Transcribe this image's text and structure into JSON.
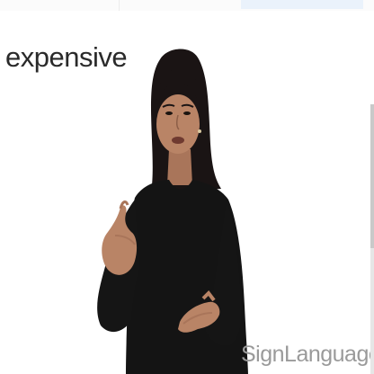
{
  "sign": {
    "word": "expensive"
  },
  "watermark": {
    "text": "SignLanguage.io"
  },
  "colors": {
    "background": "#ffffff",
    "label_text": "#2a2a2a",
    "watermark_text": "#9a9a9a",
    "clothing": "#141414",
    "skin": "#b98466",
    "hair": "#1a1414"
  }
}
